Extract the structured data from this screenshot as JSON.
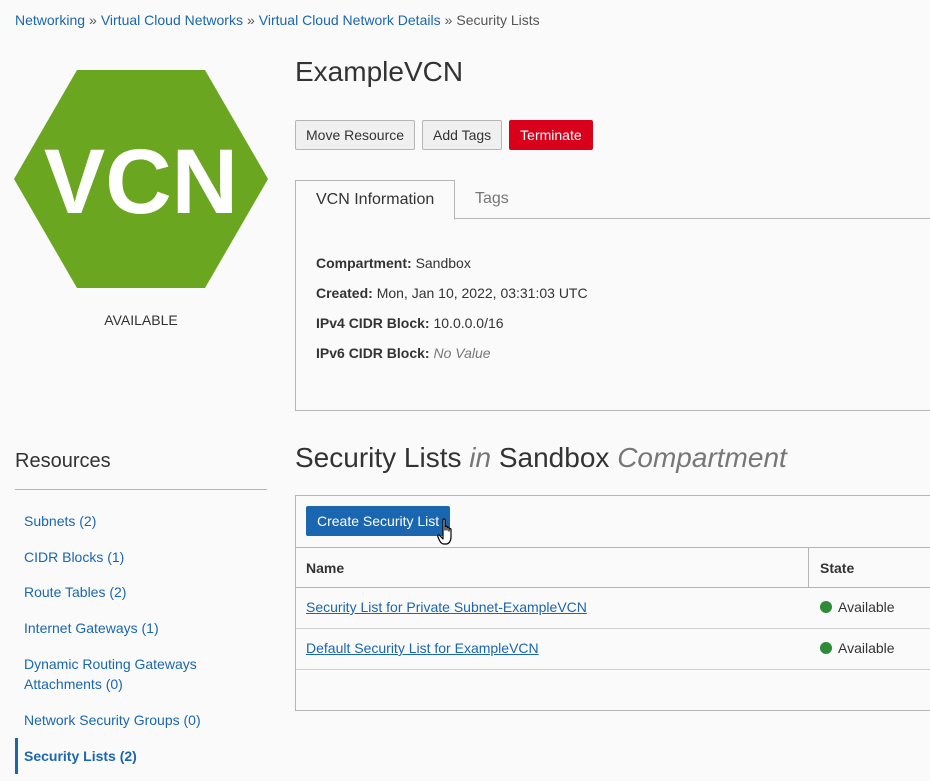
{
  "breadcrumb": {
    "items": [
      "Networking",
      "Virtual Cloud Networks",
      "Virtual Cloud Network Details"
    ],
    "separator": "»",
    "current": "Security Lists"
  },
  "vcn": {
    "logo_text": "VCN",
    "logo_color": "#6aa61f",
    "status": "AVAILABLE",
    "title": "ExampleVCN"
  },
  "actions": {
    "move": "Move Resource",
    "tags": "Add Tags",
    "terminate": "Terminate"
  },
  "tabs": {
    "info": "VCN Information",
    "tags": "Tags"
  },
  "info": {
    "compartment_label": "Compartment:",
    "compartment_value": "Sandbox",
    "created_label": "Created:",
    "created_value": "Mon, Jan 10, 2022, 03:31:03 UTC",
    "ipv4_label": "IPv4 CIDR Block:",
    "ipv4_value": "10.0.0.0/16",
    "ipv6_label": "IPv6 CIDR Block:",
    "ipv6_value": "No Value"
  },
  "resources": {
    "title": "Resources",
    "items": [
      "Subnets (2)",
      "CIDR Blocks (1)",
      "Route Tables (2)",
      "Internet Gateways (1)",
      "Dynamic Routing Gateways Attachments (0)",
      "Network Security Groups (0)",
      "Security Lists (2)"
    ]
  },
  "section": {
    "title_main": "Security Lists",
    "title_in": "in",
    "title_compartment": "Sandbox",
    "title_suffix": "Compartment"
  },
  "table": {
    "create_button": "Create Security List",
    "col_name": "Name",
    "col_state": "State",
    "rows": [
      {
        "name": "Security List for Private Subnet-ExampleVCN",
        "state": "Available"
      },
      {
        "name": "Default Security List for ExampleVCN",
        "state": "Available"
      }
    ],
    "status_color": "#2e8b36"
  }
}
